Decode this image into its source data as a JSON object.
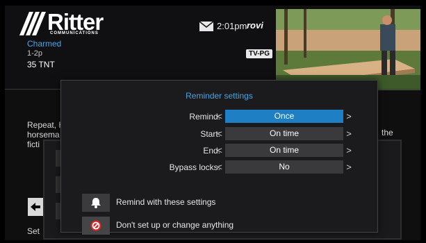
{
  "header": {
    "logo_name": "Ritter",
    "logo_sub": "COMMUNICATIONS",
    "time": "2:01pm",
    "brand": "rovi"
  },
  "program": {
    "title": "Charmed",
    "time": "1-2p",
    "channel": "35 TNT",
    "rating": "TV-PG"
  },
  "background": {
    "desc_lines": [
      "Repeat, H",
      "horsema",
      "ficti"
    ],
    "desc_right": "the",
    "set_label": "Set"
  },
  "modal": {
    "title": "Reminder settings",
    "rows": [
      {
        "label": "Remind:",
        "value": "Once"
      },
      {
        "label": "Start:",
        "value": "On time"
      },
      {
        "label": "End:",
        "value": "On time"
      },
      {
        "label": "Bypass locks:",
        "value": "No"
      }
    ],
    "arrow_left": "<",
    "arrow_right": ">",
    "actions": [
      {
        "label": "Remind with these settings",
        "icon": "bell-icon"
      },
      {
        "label": "Don't set up or change anything",
        "icon": "cancel-icon"
      }
    ]
  },
  "colors": {
    "accent": "#1f7fc4",
    "title_blue": "#4aa3df",
    "cancel_red": "#e02424"
  }
}
